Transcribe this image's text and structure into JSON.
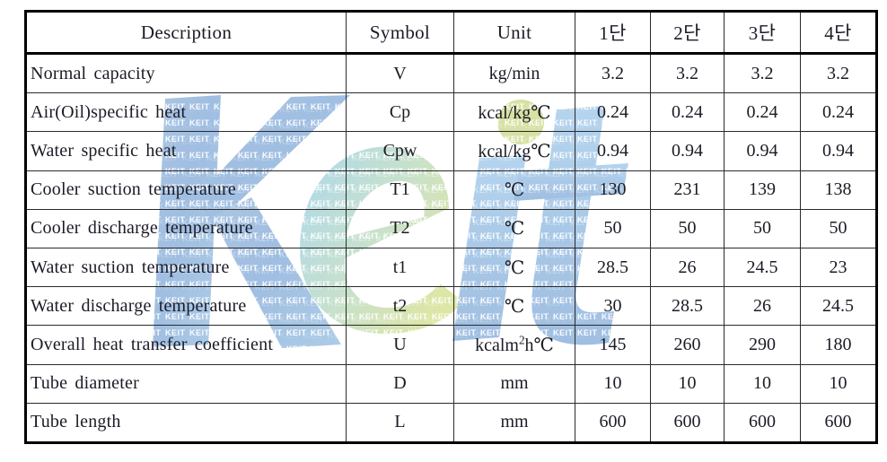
{
  "document": {
    "type": "specification-table",
    "watermark": {
      "wordmark": "Keit",
      "tile_text": "KEIT",
      "colors": {
        "blue": "#8fb4dd",
        "light_blue": "#a9d4ec",
        "green": "#c9dc8c",
        "tile": "#ffffff"
      }
    }
  },
  "table": {
    "columns": [
      {
        "key": "description",
        "label": "Description",
        "align": "left"
      },
      {
        "key": "symbol",
        "label": "Symbol",
        "align": "center"
      },
      {
        "key": "unit",
        "label": "Unit",
        "align": "center"
      },
      {
        "key": "stage1",
        "label": "1단",
        "align": "center"
      },
      {
        "key": "stage2",
        "label": "2단",
        "align": "center"
      },
      {
        "key": "stage3",
        "label": "3단",
        "align": "center"
      },
      {
        "key": "stage4",
        "label": "4단",
        "align": "center"
      }
    ],
    "rows": [
      {
        "description": "Normal capacity",
        "symbol": "V",
        "unit": "kg/min",
        "unit_sup": "",
        "unit_tail": "",
        "stage1": "3.2",
        "stage2": "3.2",
        "stage3": "3.2",
        "stage4": "3.2"
      },
      {
        "description": "Air(Oil)specific heat",
        "symbol": "Cp",
        "unit": "kcal/kg℃",
        "unit_sup": "",
        "unit_tail": "",
        "stage1": "0.24",
        "stage2": "0.24",
        "stage3": "0.24",
        "stage4": "0.24"
      },
      {
        "description": "Water specific heat",
        "symbol": "Cpw",
        "unit": "kcal/kg℃",
        "unit_sup": "",
        "unit_tail": "",
        "stage1": "0.94",
        "stage2": "0.94",
        "stage3": "0.94",
        "stage4": "0.94"
      },
      {
        "description": "Cooler suction temperature",
        "symbol": "T1",
        "unit": "℃",
        "unit_sup": "",
        "unit_tail": "",
        "stage1": "130",
        "stage2": "231",
        "stage3": "139",
        "stage4": "138"
      },
      {
        "description": "Cooler discharge temperature",
        "symbol": "T2",
        "unit": "℃",
        "unit_sup": "",
        "unit_tail": "",
        "stage1": "50",
        "stage2": "50",
        "stage3": "50",
        "stage4": "50"
      },
      {
        "description": "Water suction temperature",
        "symbol": "t1",
        "unit": "℃",
        "unit_sup": "",
        "unit_tail": "",
        "stage1": "28.5",
        "stage2": "26",
        "stage3": "24.5",
        "stage4": "23"
      },
      {
        "description": "Water discharge temperature",
        "symbol": "t2",
        "unit": "℃",
        "unit_sup": "",
        "unit_tail": "",
        "stage1": "30",
        "stage2": "28.5",
        "stage3": "26",
        "stage4": "24.5"
      },
      {
        "description": "Overall heat transfer coefficient",
        "symbol": "U",
        "unit": "kcalm",
        "unit_sup": "2",
        "unit_tail": "h℃",
        "stage1": "145",
        "stage2": "260",
        "stage3": "290",
        "stage4": "180"
      },
      {
        "description": "Tube diameter",
        "symbol": "D",
        "unit": "mm",
        "unit_sup": "",
        "unit_tail": "",
        "stage1": "10",
        "stage2": "10",
        "stage3": "10",
        "stage4": "10"
      },
      {
        "description": "Tube length",
        "symbol": "L",
        "unit": "mm",
        "unit_sup": "",
        "unit_tail": "",
        "stage1": "600",
        "stage2": "600",
        "stage3": "600",
        "stage4": "600"
      }
    ]
  }
}
